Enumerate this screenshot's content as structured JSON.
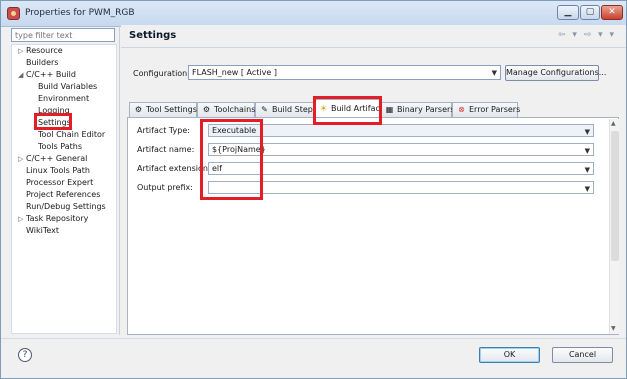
{
  "window": {
    "title": "Properties for PWM_RGB",
    "buttons": {
      "minimize": "▁",
      "maximize": "▢",
      "close": "✕"
    }
  },
  "sidebar": {
    "filter_placeholder": "type filter text",
    "items": [
      {
        "label": "Resource",
        "expander": "▷"
      },
      {
        "label": "Builders"
      },
      {
        "label": "C/C++ Build",
        "expander": "◢"
      },
      {
        "label": "Build Variables"
      },
      {
        "label": "Environment"
      },
      {
        "label": "Logging"
      },
      {
        "label": "Settings",
        "selected": true
      },
      {
        "label": "Tool Chain Editor"
      },
      {
        "label": "Tools Paths"
      },
      {
        "label": "C/C++ General",
        "expander": "▷"
      },
      {
        "label": "Linux Tools Path"
      },
      {
        "label": "Processor Expert"
      },
      {
        "label": "Project References"
      },
      {
        "label": "Run/Debug Settings"
      },
      {
        "label": "Task Repository",
        "expander": "▷"
      },
      {
        "label": "WikiText"
      }
    ]
  },
  "header": {
    "title": "Settings",
    "nav": "⇦ ▾ ⇨ ▾ ▾"
  },
  "configuration": {
    "label": "Configuration:",
    "value": "FLASH_new  [ Active ]",
    "manage_button": "Manage Configurations..."
  },
  "tabs": [
    {
      "label": "Tool Settings",
      "icon": "⚙"
    },
    {
      "label": "Toolchains",
      "icon": "⚙"
    },
    {
      "label": "Build Steps",
      "icon": "✎"
    },
    {
      "label": "Build Artifact",
      "icon": "☀",
      "active": true
    },
    {
      "label": "Binary Parsers",
      "icon": "▦"
    },
    {
      "label": "Error Parsers",
      "icon": "⊗"
    }
  ],
  "artifact": {
    "type_label": "Artifact Type:",
    "type_value": "Executable",
    "name_label": "Artifact name:",
    "name_value": "${ProjName}",
    "ext_label": "Artifact extension:",
    "ext_value": "elf",
    "prefix_label": "Output prefix:",
    "prefix_value": ""
  },
  "footer": {
    "help": "?",
    "ok": "OK",
    "cancel": "Cancel"
  },
  "colors": {
    "highlight": "#e41e26",
    "accent": "#3c7fb1"
  }
}
